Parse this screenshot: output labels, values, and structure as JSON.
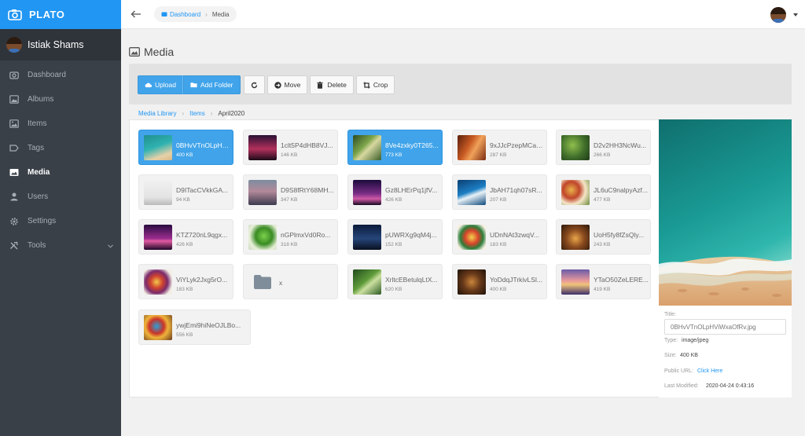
{
  "app": {
    "name": "PLATO"
  },
  "user": {
    "name": "Istiak Shams"
  },
  "sidebar": {
    "items": [
      {
        "label": "Dashboard",
        "icon": "dashboard-icon"
      },
      {
        "label": "Albums",
        "icon": "albums-icon"
      },
      {
        "label": "Items",
        "icon": "items-icon"
      },
      {
        "label": "Tags",
        "icon": "tag-icon"
      },
      {
        "label": "Media",
        "icon": "media-icon",
        "active": true
      },
      {
        "label": "Users",
        "icon": "user-icon"
      },
      {
        "label": "Settings",
        "icon": "gear-icon"
      },
      {
        "label": "Tools",
        "icon": "tools-icon"
      }
    ]
  },
  "topbar": {
    "crumb_home": "Dashboard",
    "crumb_current": "Media"
  },
  "page": {
    "title": "Media"
  },
  "toolbar": {
    "upload": "Upload",
    "add_folder": "Add Folder",
    "move": "Move",
    "delete": "Delete",
    "crop": "Crop"
  },
  "library_path": [
    "Media Library",
    "Items",
    "April2020"
  ],
  "files": [
    {
      "name": "0BHvVTnOLpHViWxaOfRv.jpg",
      "size": "400 KB",
      "selected": true
    },
    {
      "name": "1clt5P4dHB8VJ...",
      "size": "146 KB"
    },
    {
      "name": "8Ve4zxky0T265...",
      "size": "773 KB",
      "selected": true
    },
    {
      "name": "9xJJcPzepMCaH...",
      "size": "287 KB"
    },
    {
      "name": "D2v2HH3NcWu...",
      "size": "266 KB"
    },
    {
      "name": "D9ITacCVkkGA...",
      "size": "94 KB"
    },
    {
      "name": "D9S8fRtY68MH...",
      "size": "347 KB"
    },
    {
      "name": "Gz8LHErPq1jfV...",
      "size": "426 KB"
    },
    {
      "name": "JbAH71qh07sR...",
      "size": "207 KB"
    },
    {
      "name": "JL6uC9nalpyAzf...",
      "size": "477 KB"
    },
    {
      "name": "KTZ720nL9qgx...",
      "size": "426 KB"
    },
    {
      "name": "nGPlmxVd0Ro...",
      "size": "318 KB"
    },
    {
      "name": "pUWRXg9qM4j...",
      "size": "152 KB"
    },
    {
      "name": "UDnNAt3zwqV...",
      "size": "183 KB"
    },
    {
      "name": "UoH5fy8fZsQly...",
      "size": "243 KB"
    },
    {
      "name": "ViYLyk2Jxg5rO...",
      "size": "183 KB"
    },
    {
      "name": "x",
      "folder": true
    },
    {
      "name": "XrltcEBetulqLtX...",
      "size": "620 KB"
    },
    {
      "name": "YoDdqJTrkivLSl...",
      "size": "400 KB"
    },
    {
      "name": "YTaO50ZeLERE...",
      "size": "419 KB"
    },
    {
      "name": "ywjEmi9hiNeOJLBo...",
      "size": "556 KB"
    }
  ],
  "details": {
    "title_label": "Title:",
    "title_value": "0BHvVTnOLpHViWxaOfRv.jpg",
    "type_label": "Type:",
    "type_value": "image/jpeg",
    "size_label": "Size:",
    "size_value": "400 KB",
    "url_label": "Public URL:",
    "url_value": "Click Here",
    "modified_label": "Last Modified:",
    "modified_value": "2020-04-24 0:43:16"
  },
  "colors": {
    "accent": "#2196f3",
    "sidebar_bg": "#3a4048",
    "selected_tile": "#41a4ea"
  }
}
